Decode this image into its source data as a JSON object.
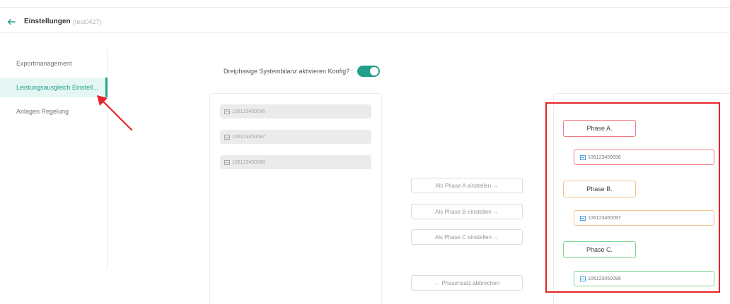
{
  "header": {
    "title": "Einstellungen",
    "subtitle": "(test0427)"
  },
  "sidebar": {
    "items": [
      {
        "label": "Exportmanagement",
        "active": false
      },
      {
        "label": "Leistungsausgleich Einstell...",
        "active": true
      },
      {
        "label": "Anlagen Regelung",
        "active": false
      }
    ]
  },
  "config": {
    "label": "Dreiphasige Systembilanz aktivieren Konfig? :",
    "enabled": true
  },
  "devices": [
    "106123450096",
    "106123450097",
    "106123450098"
  ],
  "actions": {
    "set_a": "Als Phase A einstellen →",
    "set_b": "Als Phase B einstellen →",
    "set_c": "Als Phase C einstellen →",
    "cancel": "← Phasensatz abbrechen"
  },
  "phases": [
    {
      "label": "Phase A.",
      "device": "106123450096",
      "color": "#f07a84"
    },
    {
      "label": "Phase B.",
      "device": "106123450097",
      "color": "#f5c28a"
    },
    {
      "label": "Phase C.",
      "device": "106123450098",
      "color": "#7dd88f"
    }
  ],
  "colors": {
    "accent": "#20a08a",
    "annotation": "#e8232a"
  }
}
